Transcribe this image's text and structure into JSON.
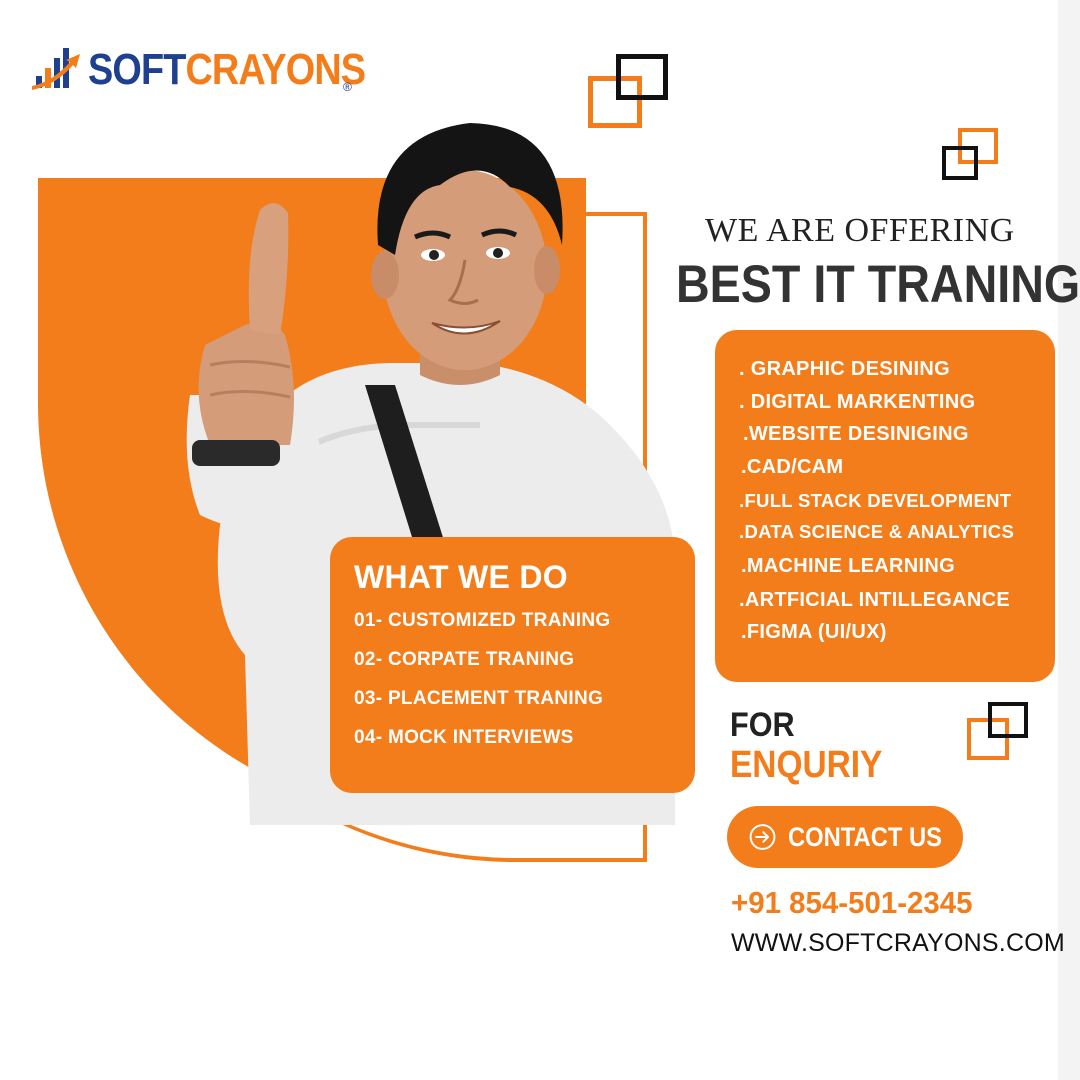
{
  "brand": {
    "name_part1": "SOFT",
    "name_part2": "CRAYONS",
    "registered": "®",
    "colors": {
      "orange": "#f27d1a",
      "navy": "#1f3f8f",
      "dark": "#222222"
    }
  },
  "headline": {
    "line1": "WE ARE OFFERING",
    "line2": "BEST IT TRANING"
  },
  "courses": [
    ". GRAPHIC DESINING",
    ". DIGITAL MARKENTING",
    ".WEBSITE DESINIGING",
    ".CAD/CAM",
    ".FULL STACK DEVELOPMENT",
    ".DATA  SCIENCE & ANALYTICS",
    ".MACHINE LEARNING",
    ".ARTFICIAL INTILLEGANCE",
    ".FIGMA (UI/UX)"
  ],
  "what_we_do": {
    "title": "WHAT WE DO",
    "items": [
      "01- CUSTOMIZED TRANING",
      "02- CORPATE TRANING",
      "03- PLACEMENT TRANING",
      "04- MOCK INTERVIEWS"
    ]
  },
  "enquiry": {
    "line1": "FOR",
    "line2": "ENQURIY",
    "button_label": "CONTACT US",
    "button_icon": "arrow-right-circle-icon",
    "phone": "+91 854-501-2345",
    "website": "WWW.SOFTCRAYONS.COM"
  },
  "hero": {
    "image": "student-thumbs-up-photo"
  }
}
